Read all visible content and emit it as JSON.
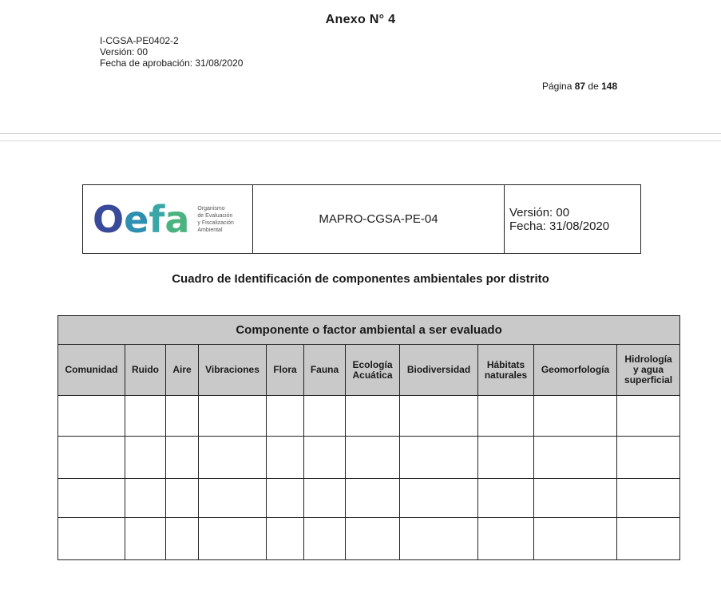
{
  "annex_title": "Anexo N° 4",
  "meta": {
    "code": "I-CGSA-PE0402-2",
    "version": "Versión: 00",
    "approval_date": "Fecha de aprobación: 31/08/2020"
  },
  "page": {
    "prefix": "Página",
    "current": "87",
    "sep": "de",
    "total": "148"
  },
  "doc_header": {
    "logo_text": "Oefa",
    "logo_subtitle": "Organismo\nde Evaluación\ny Fiscalización\nAmbiental",
    "doc_code": "MAPRO-CGSA-PE-04",
    "version": "Versión: 00",
    "date": "Fecha: 31/08/2020"
  },
  "table_title": "Cuadro de Identificación de componentes ambientales por distrito",
  "table": {
    "band": "Componente o factor ambiental a ser evaluado",
    "columns": [
      "Comunidad",
      "Ruido",
      "Aire",
      "Vibraciones",
      "Flora",
      "Fauna",
      "Ecología\nAcuática",
      "Biodiversidad",
      "Hábitats\nnaturales",
      "Geomorfología",
      "Hidrología\ny agua\nsuperficial"
    ]
  },
  "colors": {
    "header_fill": "#c9c9c9",
    "logo_o": "#3a4a9a",
    "logo_e": "#2e8fb0",
    "logo_f": "#3aa6a6",
    "logo_a": "#4bb37f"
  }
}
